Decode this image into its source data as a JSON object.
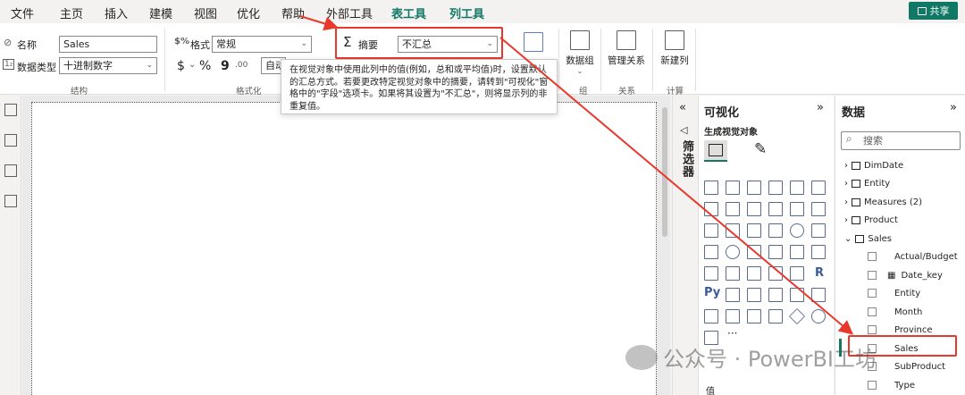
{
  "menu": {
    "items": [
      "文件",
      "主页",
      "插入",
      "建模",
      "视图",
      "优化",
      "帮助",
      "外部工具"
    ],
    "context_tabs": [
      "表工具",
      "列工具"
    ],
    "share": "共享"
  },
  "ribbon": {
    "name_label": "名称",
    "name_value": "Sales",
    "datatype_label": "数据类型",
    "datatype_value": "十进制数字",
    "group_structure": "结构",
    "format_label": "格式",
    "format_value": "常规",
    "currency_sym": "$",
    "percent_sym": "%",
    "comma_sym": "9",
    "auto_value": "自动",
    "group_formatting": "格式化",
    "summary_label": "摘要",
    "summary_value": "不汇总",
    "group_prop": "组",
    "datagroup_label": "数据组",
    "manage_rel_label": "管理关系",
    "group_rel": "关系",
    "new_column_label": "新建列",
    "group_calc": "计算"
  },
  "tooltip": {
    "text": "在视觉对象中使用此列中的值(例如，总和或平均值)时，设置默认的汇总方式。若要更改特定视觉对象中的摘要，请转到\"可视化\"窗格中的\"字段\"选项卡。如果将其设置为\"不汇总\"，则将显示列的非重复值。"
  },
  "filter_pane": {
    "label": "筛选器"
  },
  "viz_pane": {
    "title": "可视化",
    "subtitle": "生成视觉对象",
    "values_label": "值"
  },
  "data_pane": {
    "title": "数据",
    "search_placeholder": "搜索",
    "tables": [
      "DimDate",
      "Entity",
      "Measures (2)",
      "Product",
      "Sales"
    ],
    "sales_fields": [
      "Actual/Budget",
      "Date_key",
      "Entity",
      "Month",
      "Province",
      "Sales",
      "SubProduct",
      "Type"
    ]
  },
  "watermark": "公众号 · PowerBI工坊",
  "colors": {
    "accent": "#117865",
    "highlight": "#e8382c"
  }
}
